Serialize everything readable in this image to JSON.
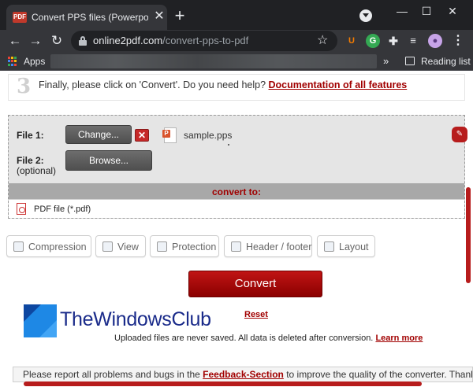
{
  "browser": {
    "tab_title": "Convert PPS files (Powerpoint) to",
    "favicon_text": "PDF",
    "url_host": "online2pdf.com",
    "url_path": "/convert-pps-to-pdf",
    "new_tab_glyph": "+",
    "close_glyph": "✕",
    "controls": {
      "minimize": "—",
      "maximize": "☐",
      "close": "✕"
    },
    "nav_glyphs": {
      "back": "←",
      "forward": "→",
      "reload": "↻",
      "star": "☆",
      "more": "⋮",
      "reading_list_more": "»"
    },
    "extensions": [
      "U",
      "G",
      "",
      "",
      ""
    ],
    "bookmarks": {
      "apps_label": "Apps",
      "reading_list_label": "Reading list"
    },
    "colors": {
      "frame": "#202124",
      "toolbar": "#35363a",
      "text": "#e8eaed",
      "muted": "#9aa0a6"
    }
  },
  "step3": {
    "number": "3",
    "text": "Finally, please click on 'Convert'. Do you need help?",
    "link": "Documentation of all features"
  },
  "files": {
    "file1_label": "File 1:",
    "change_button": "Change...",
    "remove_glyph": "✕",
    "file1_name": "sample.pps",
    "file2_label": "File 2:",
    "file2_sub": "(optional)",
    "browse_button": "Browse..."
  },
  "convert_to": {
    "label": "convert to:",
    "format": "PDF file (*.pdf)"
  },
  "options": [
    {
      "label": "Compression",
      "icon": "compression-icon"
    },
    {
      "label": "View",
      "icon": "view-icon"
    },
    {
      "label": "Protection",
      "icon": "lock-icon"
    },
    {
      "label": "Header / footer",
      "icon": "header-footer-icon"
    },
    {
      "label": "Layout",
      "icon": "layout-icon"
    }
  ],
  "actions": {
    "convert": "Convert",
    "reset": "Reset",
    "notice": "Uploaded files are never saved. All data is deleted after conversion.",
    "learn_more": "Learn more"
  },
  "watermark": {
    "text": "TheWindowsClub"
  },
  "report": {
    "prefix": "Please report all problems and bugs in the",
    "link": "Feedback-Section",
    "suffix": "to improve the quality of the converter. Thank"
  },
  "colors": {
    "accent": "#a10000",
    "button_dark": "#4f4f4f",
    "scrollbar": "#b71c1c"
  }
}
